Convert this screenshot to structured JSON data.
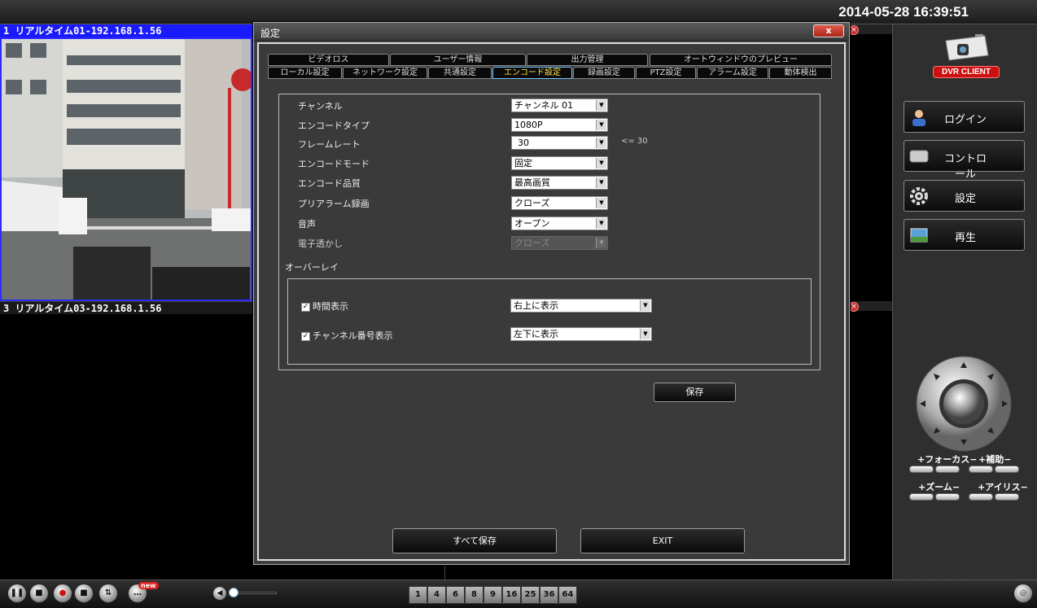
{
  "clock": "2014-05-28 16:39:51",
  "cameras": {
    "cam1_header": "1 リアルタイム01-192.168.1.56",
    "cam3_header": "3 リアルタイム03-192.168.1.56"
  },
  "dialog": {
    "title": "設定",
    "close": "x",
    "tabs_row1": [
      "ビデオロス",
      "ユーザー情報",
      "出力管理",
      "オートウィンドウのプレビュー"
    ],
    "tabs_row2": [
      "ローカル設定",
      "ネットワーク設定",
      "共通設定",
      "エンコード設定",
      "録画設定",
      "PTZ設定",
      "アラーム設定",
      "動体検出"
    ],
    "active_tab": "エンコード設定",
    "rows": [
      {
        "label": "チャンネル",
        "value": "チャンネル 01"
      },
      {
        "label": "エンコードタイプ",
        "value": "1080P"
      },
      {
        "label": "フレームレート",
        "value": "30"
      },
      {
        "label": "エンコードモード",
        "value": "固定"
      },
      {
        "label": "エンコード品質",
        "value": "最高画質"
      },
      {
        "label": "プリアラーム録画",
        "value": "クローズ"
      },
      {
        "label": "音声",
        "value": "オープン"
      },
      {
        "label": "電子透かし",
        "value": "クローズ"
      }
    ],
    "fps_hint": "<= 30",
    "overlay": {
      "label": "オーバーレイ",
      "time_display": {
        "label": "時間表示",
        "checked": true,
        "value": "右上に表示"
      },
      "channel_display": {
        "label": "チャンネル番号表示",
        "checked": true,
        "value": "左下に表示"
      }
    },
    "save_label": "保存",
    "save_all_label": "すべて保存",
    "exit_label": "EXIT"
  },
  "sidebar": {
    "logo_text": "DVR CLIENT",
    "buttons": [
      "ログイン",
      "コントロール",
      "設定",
      "再生"
    ],
    "ptz": {
      "focus": "+フォーカス−",
      "aux": "+補助−",
      "zoom": "+ズーム−",
      "iris": "+アイリス−"
    }
  },
  "bottombar": {
    "badge": "new",
    "layouts": [
      "1",
      "4",
      "6",
      "8",
      "9",
      "16",
      "25",
      "36",
      "64"
    ]
  },
  "colors": {
    "active_tab_text": "#ffe44a",
    "cam_header": "#1a1aff",
    "logo_red": "#cc1111"
  }
}
